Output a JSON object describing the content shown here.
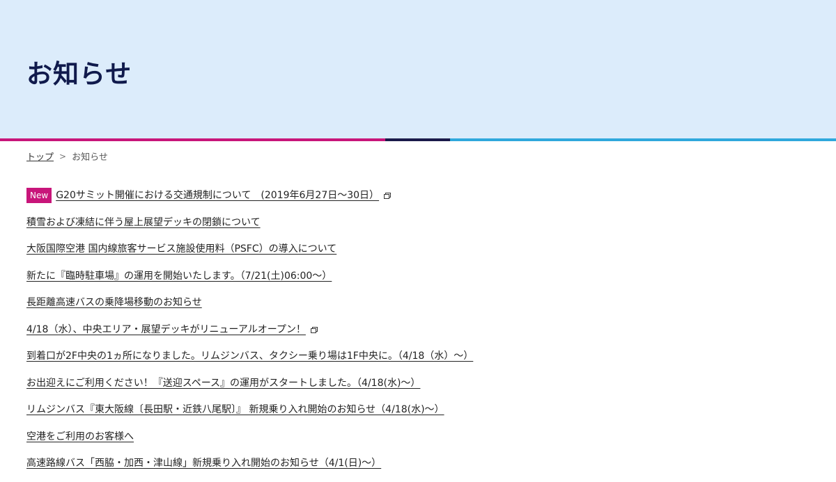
{
  "page_title": "お知らせ",
  "colors": {
    "hero_bg": "#dcecfb",
    "title": "#101a4c",
    "stripe_pink": "#c8157a",
    "stripe_navy": "#1a1a4a",
    "stripe_blue": "#2fa8dc",
    "badge": "#c8157a"
  },
  "breadcrumb": {
    "home": "トップ",
    "separator": ">",
    "current": "お知らせ"
  },
  "news": [
    {
      "badge": "New",
      "title": "G20サミット開催における交通規制について　(2019年6月27日～30日）",
      "external": true
    },
    {
      "badge": "",
      "title": "積雪および凍結に伴う屋上展望デッキの閉鎖について",
      "external": false
    },
    {
      "badge": "",
      "title": "大阪国際空港 国内線旅客サービス施設使用料（PSFC）の導入について",
      "external": false
    },
    {
      "badge": "",
      "title": "新たに『臨時駐車場』の運用を開始いたします。（7/21(土)06:00～）",
      "external": false
    },
    {
      "badge": "",
      "title": "長距離高速バスの乗降場移動のお知らせ",
      "external": false
    },
    {
      "badge": "",
      "title": "4/18（水）、中央エリア・展望デッキがリニューアルオープン！",
      "external": true
    },
    {
      "badge": "",
      "title": "到着口が2F中央の1ヵ所になりました。リムジンバス、タクシー乗り場は1F中央に。（4/18（水）～）",
      "external": false
    },
    {
      "badge": "",
      "title": "お出迎えにご利用ください！『送迎スペース』の運用がスタートしました。（4/18(水)～）",
      "external": false
    },
    {
      "badge": "",
      "title": "リムジンバス『東大阪線〔長田駅・近鉄八尾駅〕』 新規乗り入れ開始のお知らせ（4/18(水)～）",
      "external": false
    },
    {
      "badge": "",
      "title": "空港をご利用のお客様へ",
      "external": false
    },
    {
      "badge": "",
      "title": "高速路線バス「西脇・加西・津山線」新規乗り入れ開始のお知らせ（4/1(日)～）",
      "external": false
    }
  ]
}
